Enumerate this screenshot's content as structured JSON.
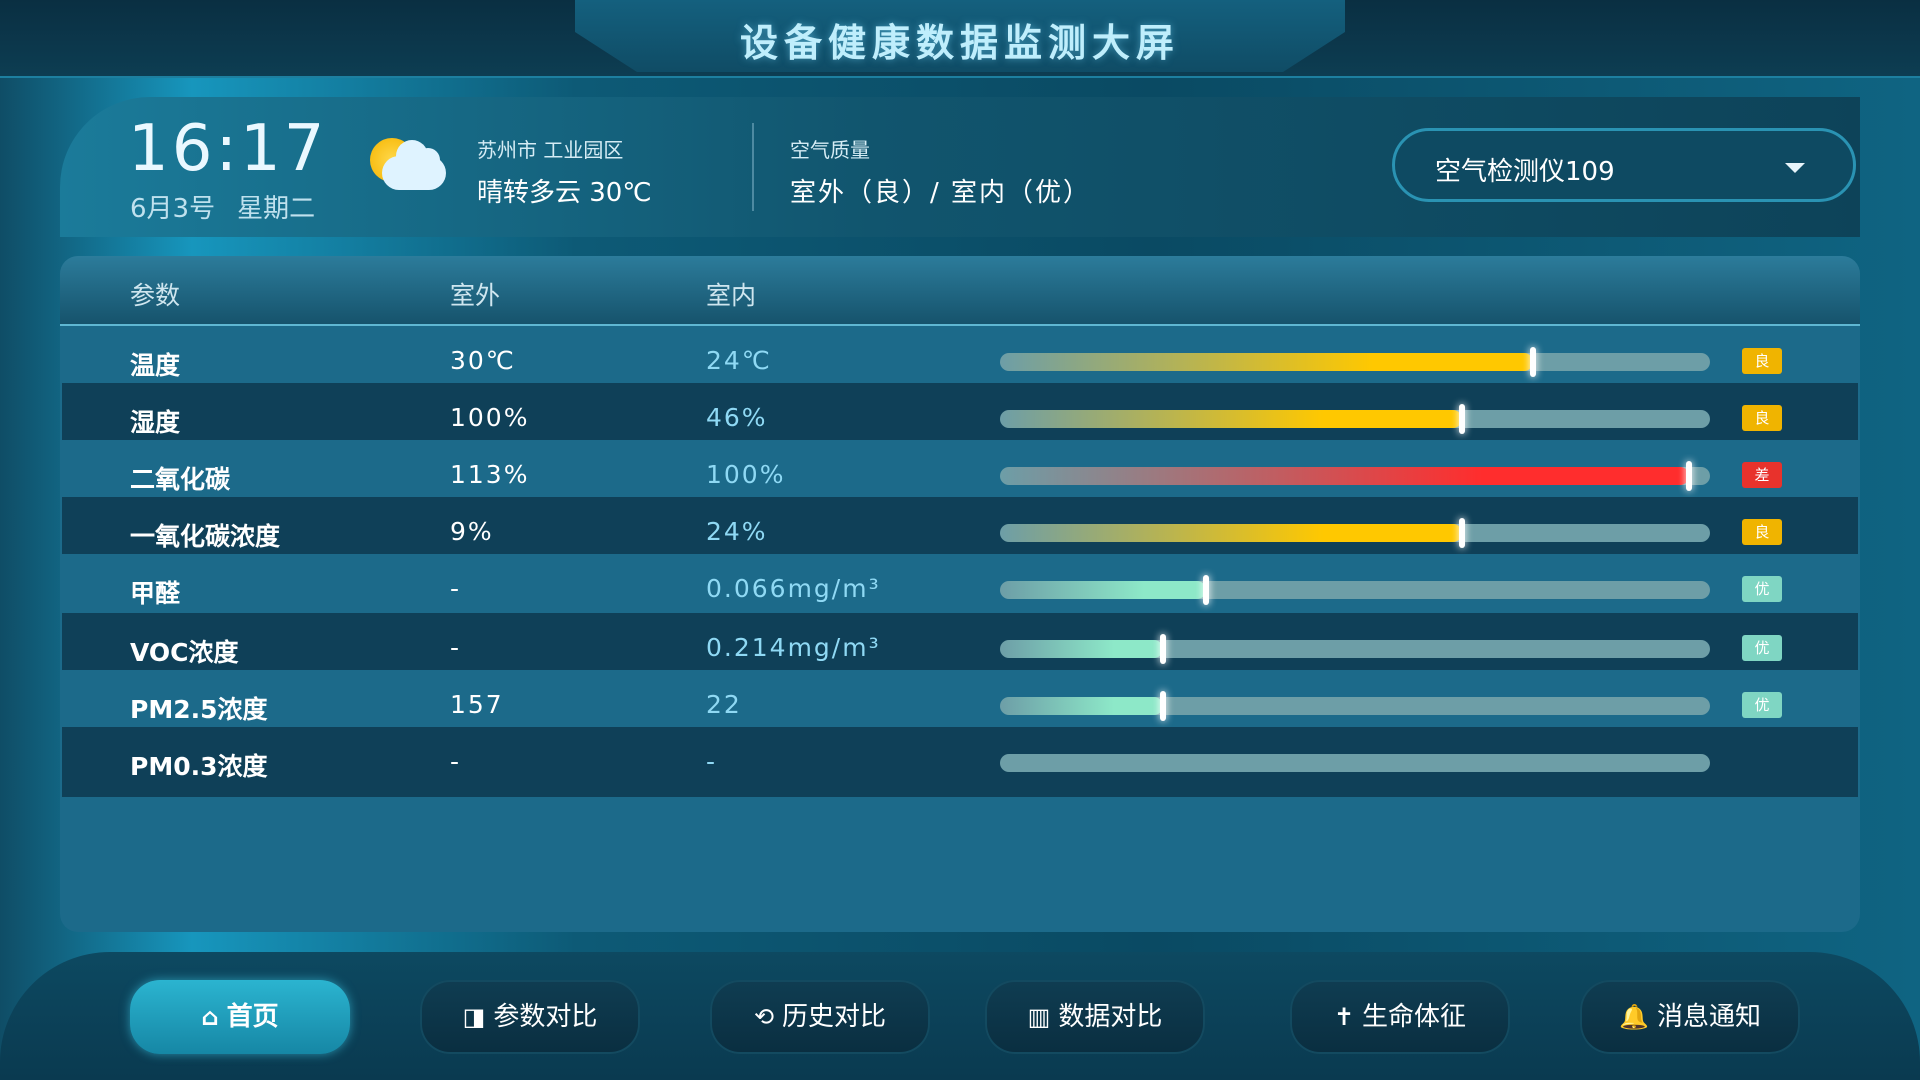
{
  "header": {
    "title": "设备健康数据监测大屏"
  },
  "info": {
    "time": "16:17",
    "date": "6月3号",
    "weekday": "星期二",
    "location": "苏州市 工业园区",
    "weather": "晴转多云  30℃",
    "air_quality_label": "空气质量",
    "air_quality_value": "室外（良）/ 室内（优）",
    "device_selected": "空气检测仪109",
    "weather_icon": "partly-cloudy-icon"
  },
  "table": {
    "headers": {
      "param": "参数",
      "outdoor": "室外",
      "indoor": "室内"
    },
    "rows": [
      {
        "param": "温度",
        "outdoor": "30℃",
        "indoor": "24℃",
        "level": 0.75,
        "color": "#ffc800",
        "badge": "良"
      },
      {
        "param": "湿度",
        "outdoor": "100%",
        "indoor": "46%",
        "level": 0.65,
        "color": "#ffc800",
        "badge": "良"
      },
      {
        "param": "二氧化碳",
        "outdoor": "113%",
        "indoor": "100%",
        "level": 0.97,
        "color": "#ff2d2d",
        "badge": "差"
      },
      {
        "param": "一氧化碳浓度",
        "outdoor": "9%",
        "indoor": "24%",
        "level": 0.65,
        "color": "#ffc800",
        "badge": "良"
      },
      {
        "param": "甲醛",
        "outdoor": "-",
        "indoor": "0.066mg/m³",
        "level": 0.29,
        "color": "#8de8c8",
        "badge": "优"
      },
      {
        "param": "VOC浓度",
        "outdoor": "-",
        "indoor": "0.214mg/m³",
        "level": 0.23,
        "color": "#8de8c8",
        "badge": "优"
      },
      {
        "param": "PM2.5浓度",
        "outdoor": "157",
        "indoor": "22",
        "level": 0.23,
        "color": "#8de8c8",
        "badge": "优"
      },
      {
        "param": "PM0.3浓度",
        "outdoor": "-",
        "indoor": "-",
        "level": 0,
        "color": "",
        "badge": ""
      }
    ],
    "badge_colors": {
      "良": "#f0b400",
      "差": "#e8322c",
      "优": "#7fd6c3"
    }
  },
  "nav": [
    {
      "label": "首页",
      "icon": "home-icon",
      "glyph": "⌂",
      "active": true
    },
    {
      "label": "参数对比",
      "icon": "compare-icon",
      "glyph": "◨",
      "active": false
    },
    {
      "label": "历史对比",
      "icon": "history-icon",
      "glyph": "⟲",
      "active": false
    },
    {
      "label": "数据对比",
      "icon": "bar-chart-icon",
      "glyph": "▥",
      "active": false
    },
    {
      "label": "生命体征",
      "icon": "person-icon",
      "glyph": "✝",
      "active": false
    },
    {
      "label": "消息通知",
      "icon": "bell-icon",
      "glyph": "🔔",
      "active": false
    }
  ]
}
